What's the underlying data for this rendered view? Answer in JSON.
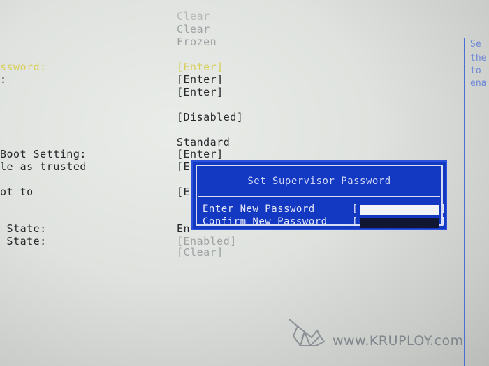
{
  "rows_left": {
    "r3": "ssword:",
    "r4": ":",
    "r8": "Boot Setting:",
    "r9": "le as trusted",
    "r10": "ot to",
    "r11": " State:",
    "r12": " State:"
  },
  "rows_right": {
    "r0": "Clear",
    "r1": "Clear",
    "r2": "Frozen",
    "r3": "[Enter]",
    "r4": "[Enter]",
    "r5": "[Enter]",
    "r6": "[Disabled]",
    "r7": "Standard",
    "r8": "[Enter]",
    "r9": "[E",
    "r10": "[E",
    "r11": "En",
    "r12": "[Enabled]",
    "r13": "[Clear]"
  },
  "help": {
    "l1": "Se",
    "l2": "the",
    "l3": "to",
    "l4": "ena"
  },
  "dialog": {
    "title": "Set Supervisor Password",
    "enter_label": "Enter New Password",
    "confirm_label": "Confirm New Password",
    "bracket_open": "[",
    "bracket_close": "]"
  },
  "watermark": {
    "text": "www.KRUPLOY.com"
  },
  "colors": {
    "background": "#dfe2de",
    "dialog_blue": "#1338c2",
    "highlight_yellow": "#d8d05a",
    "border_blue": "#4a6fd3"
  }
}
